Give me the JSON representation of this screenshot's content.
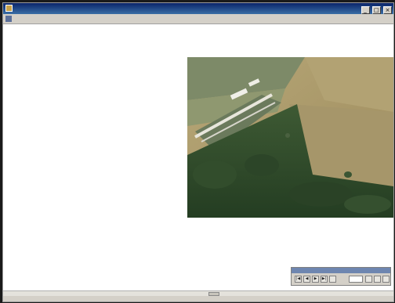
{
  "window": {
    "title": "",
    "buttons": [
      "_",
      "□",
      "×"
    ]
  },
  "menu": {
    "items": [
      "",
      "",
      "",
      "",
      "",
      ""
    ]
  },
  "photo_panel": {
    "label": ""
  },
  "fields": [
    {
      "label": "",
      "value": ""
    },
    {
      "label": "",
      "value": ""
    },
    {
      "label": "",
      "value": ""
    },
    {
      "label": "",
      "value": ""
    },
    {
      "label": "",
      "value": ""
    },
    {
      "label": "",
      "value": ""
    },
    {
      "label": "",
      "value": ""
    },
    {
      "label": "",
      "value": ""
    },
    {
      "label": "",
      "value": ""
    },
    {
      "label": "",
      "value": ""
    },
    {
      "label": "",
      "value": ""
    },
    {
      "label": "",
      "value": ""
    },
    {
      "label": "",
      "value": ""
    },
    {
      "label": "",
      "value": ""
    },
    {
      "label": "",
      "value": ""
    },
    {
      "label": "",
      "value": ""
    },
    {
      "label": "",
      "value": ""
    },
    {
      "label": "",
      "value": ""
    },
    {
      "label": "",
      "value": ""
    },
    {
      "label": "",
      "value": ""
    },
    {
      "label": "",
      "value": ""
    },
    {
      "label": "",
      "value": ""
    },
    {
      "label": "",
      "value": ""
    },
    {
      "label": "",
      "value": ""
    },
    {
      "label": "",
      "value": ""
    },
    {
      "label": "",
      "value": ""
    },
    {
      "label": "",
      "value": ""
    }
  ],
  "extra_fields": [
    {
      "label": "",
      "value": ""
    },
    {
      "label": "",
      "value": ""
    },
    {
      "label": "",
      "value": ""
    }
  ],
  "player": {
    "title": "",
    "position": "",
    "buttons": [
      "|◀",
      "◀",
      "▶",
      "▶|",
      "",
      ""
    ]
  },
  "statusbar": {
    "cells": [
      "",
      "",
      "",
      "",
      ""
    ]
  }
}
